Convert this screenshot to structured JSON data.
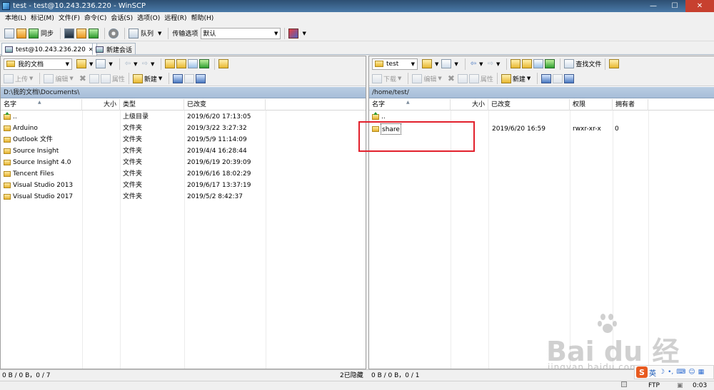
{
  "window": {
    "title": "test - test@10.243.236.220 - WinSCP"
  },
  "menu": [
    "本地(L)",
    "标记(M)",
    "文件(F)",
    "命令(C)",
    "会话(S)",
    "选项(O)",
    "远程(R)",
    "帮助(H)"
  ],
  "toolbar": {
    "sync_label": "同步",
    "queue_label": "队列",
    "transfer_options_label": "传输选项",
    "transfer_preset": "默认"
  },
  "tabs": {
    "session": "test@10.243.236.220",
    "new_session": "新建会话"
  },
  "left_panel": {
    "location": "我的文档",
    "actions": {
      "upload": "上传",
      "edit": "编辑",
      "properties": "属性",
      "new": "新建"
    },
    "path": "D:\\我的文档\\Documents\\",
    "columns": {
      "name": "名字",
      "size": "大小",
      "type": "类型",
      "changed": "已改变"
    },
    "files": [
      {
        "name": "..",
        "type": "上级目录",
        "changed": "2019/6/20  17:13:05",
        "icon": "parent-folder-icon"
      },
      {
        "name": "Arduino",
        "type": "文件夹",
        "changed": "2019/3/22  3:27:32",
        "icon": "folder-icon"
      },
      {
        "name": "Outlook 文件",
        "type": "文件夹",
        "changed": "2019/5/9  11:14:09",
        "icon": "folder-icon"
      },
      {
        "name": "Source Insight",
        "type": "文件夹",
        "changed": "2019/4/4  16:28:44",
        "icon": "folder-icon"
      },
      {
        "name": "Source Insight 4.0",
        "type": "文件夹",
        "changed": "2019/6/19  20:39:09",
        "icon": "folder-icon"
      },
      {
        "name": "Tencent Files",
        "type": "文件夹",
        "changed": "2019/6/16  18:02:29",
        "icon": "folder-icon"
      },
      {
        "name": "Visual Studio 2013",
        "type": "文件夹",
        "changed": "2019/6/17  13:37:19",
        "icon": "folder-icon"
      },
      {
        "name": "Visual Studio 2017",
        "type": "文件夹",
        "changed": "2019/5/2  8:42:37",
        "icon": "folder-icon"
      }
    ],
    "status": "0 B / 0 B，0 / 7",
    "hidden": "2已隐藏"
  },
  "right_panel": {
    "location": "test",
    "actions": {
      "download": "下载",
      "edit": "编辑",
      "properties": "属性",
      "new": "新建",
      "find": "查找文件"
    },
    "path": "/home/test/",
    "columns": {
      "name": "名字",
      "size": "大小",
      "changed": "已改变",
      "rights": "权限",
      "owner": "拥有者"
    },
    "files": [
      {
        "name": "..",
        "changed": "",
        "rights": "",
        "owner": "",
        "icon": "parent-folder-icon"
      },
      {
        "name": "share",
        "changed": "2019/6/20 16:59",
        "rights": "rwxr-xr-x",
        "owner": "0",
        "icon": "folder-icon"
      }
    ],
    "status": "0 B / 0 B，0 / 1"
  },
  "bottom": {
    "protocol": "FTP",
    "time": "0:03"
  },
  "ime": {
    "lang": "英"
  },
  "watermark": {
    "brand": "Bai  du 经验",
    "url": "jingyan.baidu.com"
  },
  "colors": {
    "highlight": "#e2202c",
    "titlebar": "#3a6390",
    "pathbar": "#b2c7df"
  }
}
